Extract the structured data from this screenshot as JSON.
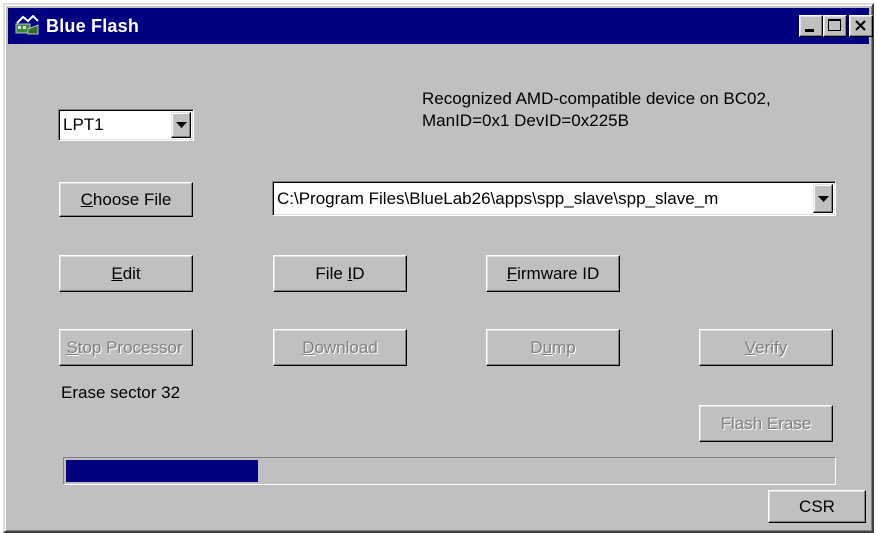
{
  "window": {
    "title": "Blue Flash",
    "controls": [
      "minimize-icon",
      "maximize-icon",
      "close-icon"
    ]
  },
  "port": {
    "selected": "LPT1"
  },
  "status": {
    "device_line1": "Recognized AMD-compatible device on BC02,",
    "device_line2": "ManID=0x1 DevID=0x225B",
    "operation": "Erase sector 32"
  },
  "file": {
    "choose_label": "Choose File",
    "path": "C:\\Program Files\\BlueLab26\\apps\\spp_slave\\spp_slave_m"
  },
  "buttons": {
    "edit": "Edit",
    "file_id": "File ID",
    "firmware_id": "Firmware ID",
    "stop_processor": "Stop Processor",
    "download": "Download",
    "dump": "Dump",
    "verify": "Verify",
    "flash_erase": "Flash Erase",
    "csr": "CSR"
  },
  "progress": {
    "fraction": 0.25,
    "color": "#000080"
  },
  "colors": {
    "titlebar": "#000080",
    "face": "#c0c0c0",
    "disabled_text": "#808080"
  }
}
